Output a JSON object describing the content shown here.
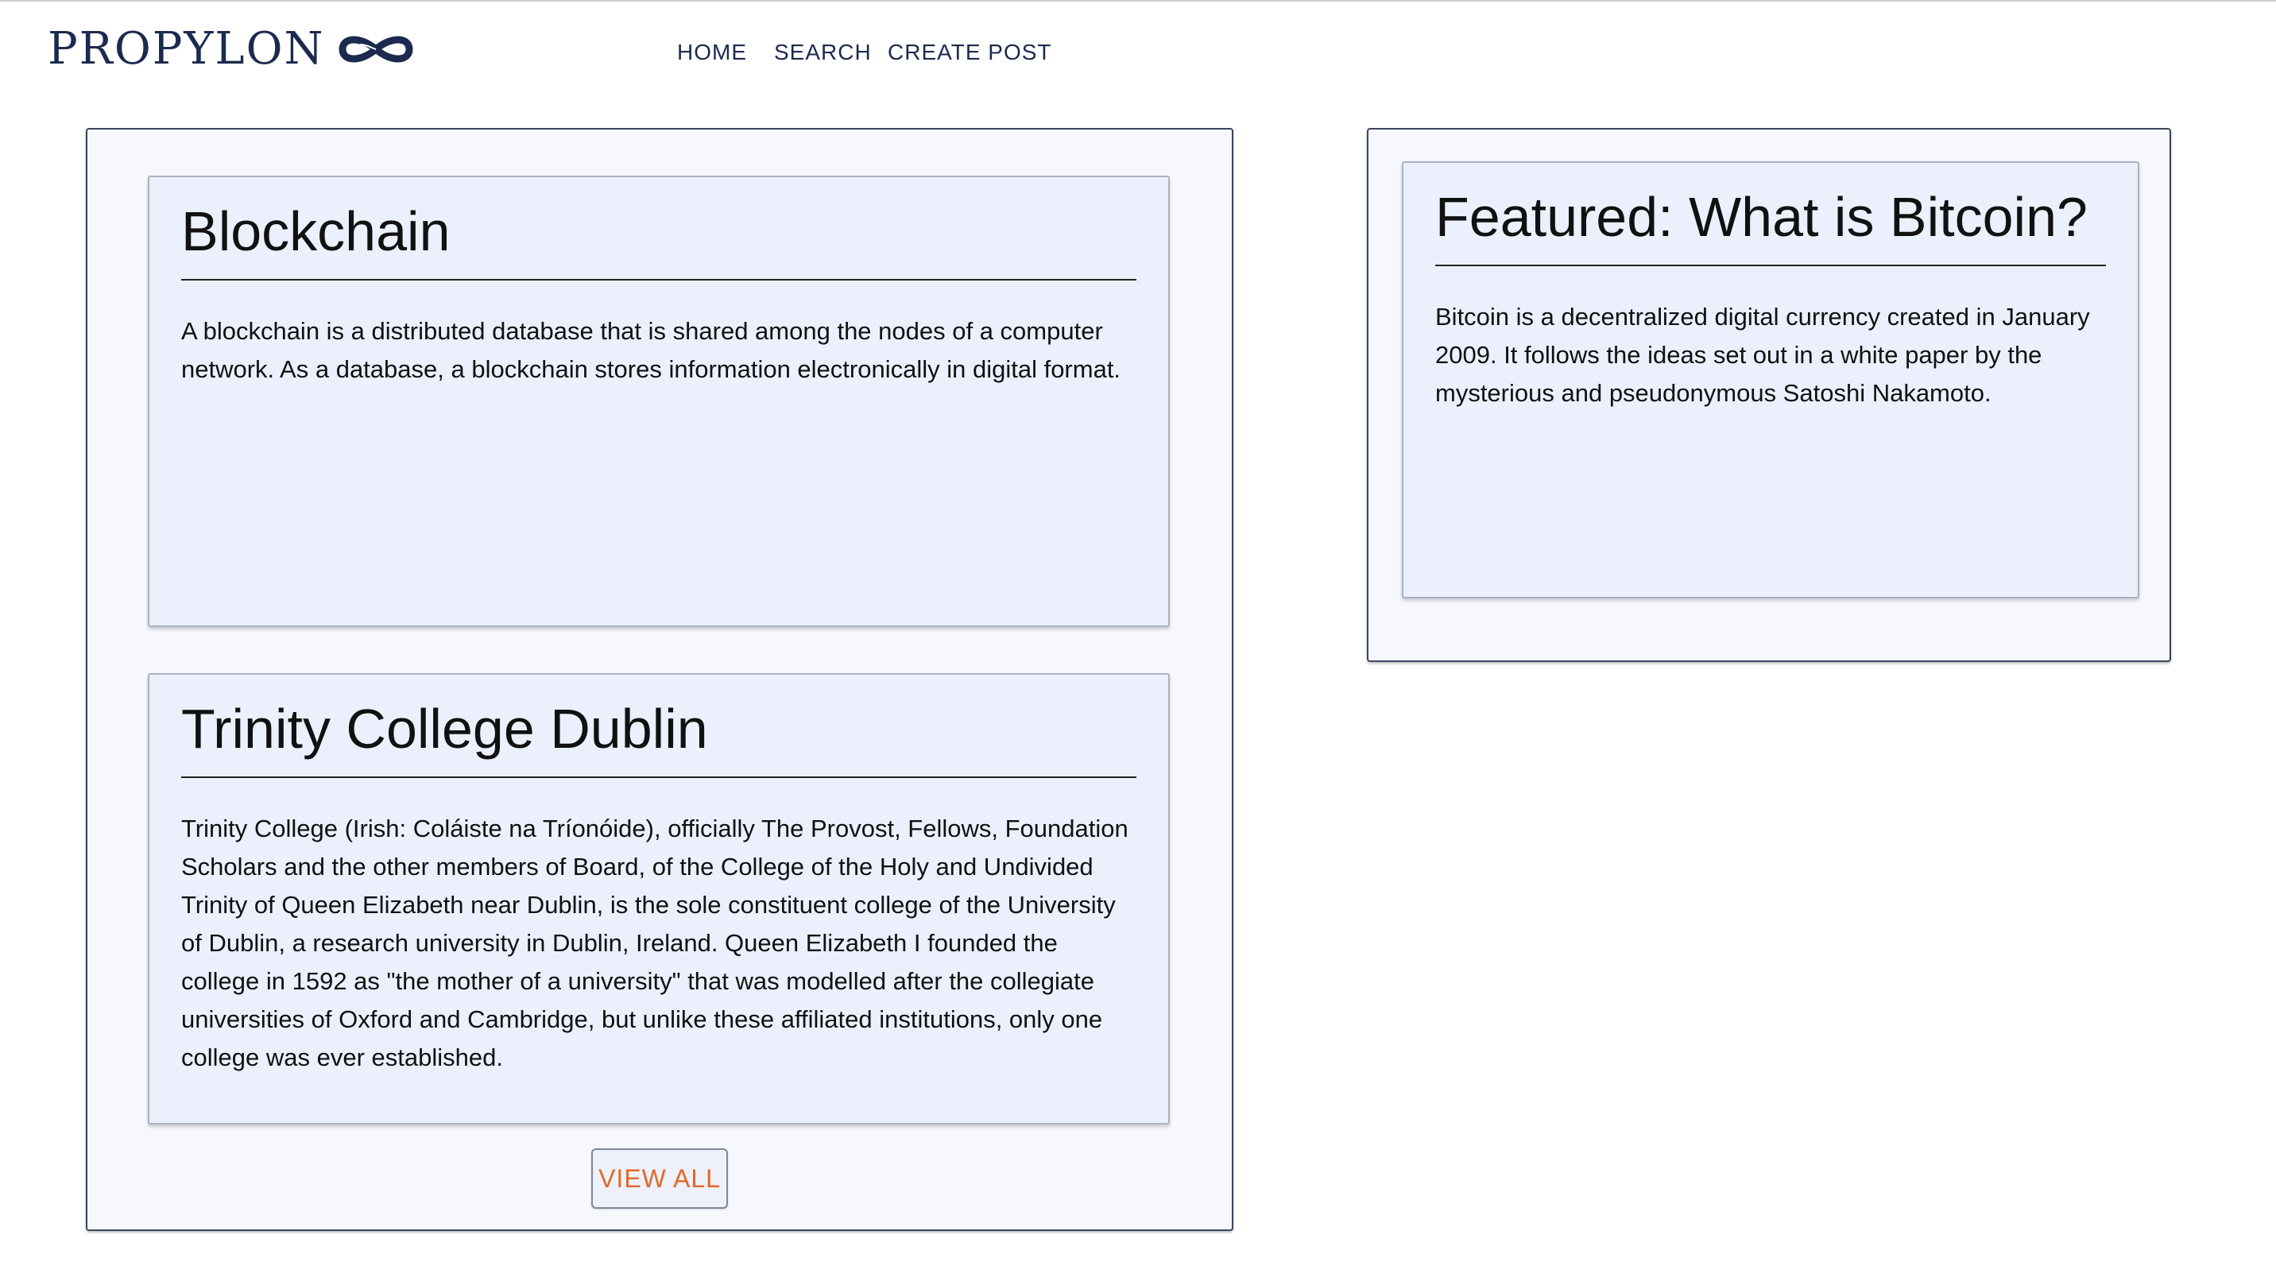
{
  "header": {
    "logo_text": "PROPYLON",
    "logo_icon": "infinity-logo-icon",
    "nav": [
      {
        "label": "HOME"
      },
      {
        "label": "SEARCH"
      },
      {
        "label": "CREATE POST"
      }
    ]
  },
  "posts": [
    {
      "title": "Blockchain",
      "body": "A blockchain is a distributed database that is shared among the nodes of a computer network. As a database, a blockchain stores information electronically in digital format."
    },
    {
      "title": "Trinity College Dublin",
      "body": "Trinity College (Irish: Coláiste na Tríonóide), officially The Provost, Fellows, Foundation Scholars and the other members of Board, of the College of the Holy and Undivided Trinity of Queen Elizabeth near Dublin, is the sole constituent college of the University of Dublin, a research university in Dublin, Ireland. Queen Elizabeth I founded the college in 1592 as \"the mother of a university\" that was modelled after the collegiate universities of Oxford and Cambridge, but unlike these affiliated institutions, only one college was ever established."
    }
  ],
  "view_all_label": "VIEW ALL",
  "featured": {
    "title": "Featured: What is Bitcoin?",
    "body": "Bitcoin is a decentralized digital currency created in January 2009. It follows the ideas set out in a white paper by the mysterious and pseudonymous Satoshi Nakamoto."
  },
  "colors": {
    "brand_navy": "#1b2a4e",
    "accent_orange": "#e2692a",
    "card_bg": "#ebf0fc",
    "panel_bg": "#f7f8fd"
  }
}
